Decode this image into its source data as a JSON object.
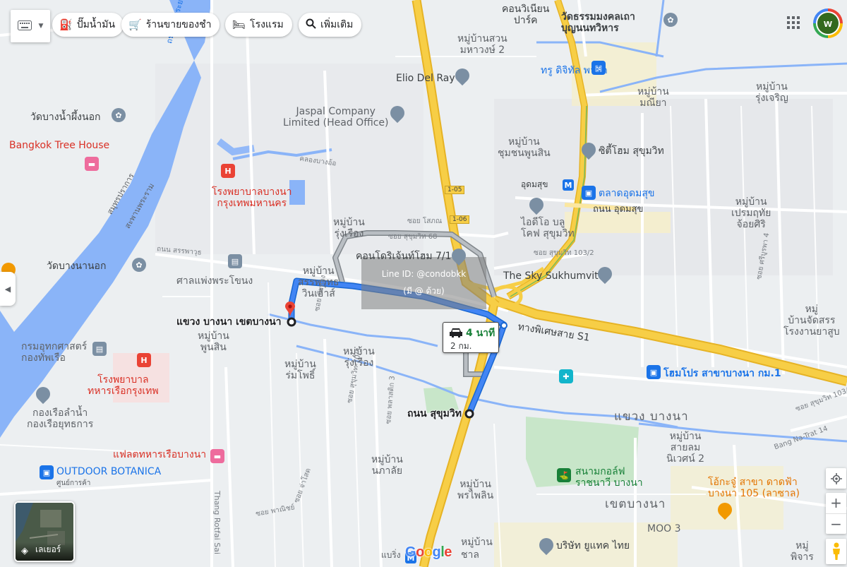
{
  "toolbar": {
    "keyboard_icon": "keyboard-icon",
    "chips": [
      {
        "icon": "gas-station-icon",
        "label": "ปั๊มน้ำมัน"
      },
      {
        "icon": "shopping-cart-icon",
        "label": "ร้านขายของชำ"
      },
      {
        "icon": "hotel-bed-icon",
        "label": "โรงแรม"
      },
      {
        "icon": "search-icon",
        "label": "เพิ่มเติม"
      }
    ],
    "avatar_letter": "w"
  },
  "route": {
    "duration": "4 นาที",
    "distance": "2 กม.",
    "destination_label": "แขวง บางนา เขตบางนา",
    "origin_label": "ถนน สุขุมวิท",
    "color": "#4285f4",
    "alt_color": "#9aa0a6"
  },
  "watermark": {
    "line1": "Line ID: @condobkk",
    "line2": "(มี @ ด้วย)"
  },
  "places": [
    {
      "text": "คอนวิเนียน\nปาร์ค",
      "style": "place-dark"
    },
    {
      "text": "หมู่บ้านสวน\nมหาวงษ์ 2",
      "style": "place"
    },
    {
      "text": "วัดธรรมมงคลเถา\nบุญนนทวิหาร",
      "style": "place-dark"
    },
    {
      "text": "Elio Del Ray",
      "style": "place-dark"
    },
    {
      "text": "ทรู ดิจิทัล พาร์ค",
      "style": "blue-plain"
    },
    {
      "text": "หมู่บ้าน\nมณียา",
      "style": "place"
    },
    {
      "text": "หมู่บ้าน\nรุ่งเจริญ",
      "style": "place"
    },
    {
      "text": "วัดบางน้ำผึ้งนอก",
      "style": "place-dark"
    },
    {
      "text": "Bangkok Tree House",
      "style": "red"
    },
    {
      "text": "Jaspal Company\nLimited (Head Office)",
      "style": "place"
    },
    {
      "text": "หมู่บ้าน\nชุมชนพูนสิน",
      "style": "place"
    },
    {
      "text": "ซิตี้โฮม สุขุมวิท",
      "style": "place-dark"
    },
    {
      "text": "อุดมสุข",
      "style": "place-dark"
    },
    {
      "text": "ตลาดอุดมสุข",
      "style": "blue-plain"
    },
    {
      "text": "โรงพยาบาลบางนา\nกรุงเทพมหานคร",
      "style": "red"
    },
    {
      "text": "หมู่บ้าน\nรุ่งเรือง",
      "style": "place"
    },
    {
      "text": "ไอดีโอ บลู\nโคฟ สุขุมวิท",
      "style": "place"
    },
    {
      "text": "หมู่บ้าน\nเปรมฤทัย\nจ้อยศิริ",
      "style": "place"
    },
    {
      "text": "คอนโดริเจ้นท์โฮม 7/1",
      "style": "place-dark"
    },
    {
      "text": "วัดบางนานอก",
      "style": "place-dark"
    },
    {
      "text": "หมู่บ้าน\nสรรพวุทธ\nวินเฮ้าส์",
      "style": "place"
    },
    {
      "text": "ศาลแพ่งพระโขนง",
      "style": "place"
    },
    {
      "text": "The Sky Sukhumvit",
      "style": "place-dark"
    },
    {
      "text": "หมู่\nบ้านจัดสรร\nโรงงานยาสูบ",
      "style": "place"
    },
    {
      "text": "หมู่บ้าน\nพูนสิน",
      "style": "place"
    },
    {
      "text": "ทางพิเศษสาย S1",
      "style": "place-dark"
    },
    {
      "text": "กรมอุทกศาสตร์\nกองทัพเรือ",
      "style": "place"
    },
    {
      "text": "หมู่บ้าน\nรุ่งเรือง",
      "style": "place"
    },
    {
      "text": "หมู่บ้าน\nร่มโพธิ์",
      "style": "place"
    },
    {
      "text": "โรงพยาบาล\nทหารเรือกรุงเทพ",
      "style": "red"
    },
    {
      "text": "โฮมโปร สาขาบางนา กม.1",
      "style": "blue"
    },
    {
      "text": "กองเรือลำน้ำ\nกองเรือยุทธการ",
      "style": "place"
    },
    {
      "text": "แขวง บางนา",
      "style": "area-big"
    },
    {
      "text": "หมู่บ้าน\nสายลม\nนิเวศน์ 2",
      "style": "place"
    },
    {
      "text": "แฟลตทหารเรือบางนา",
      "style": "red"
    },
    {
      "text": "OUTDOOR BOTANICA",
      "style": "blue-plain"
    },
    {
      "text": "ศูนย์การค้า",
      "style": "small"
    },
    {
      "text": "หมู่บ้าน\nนภาลัย",
      "style": "place"
    },
    {
      "text": "สนามกอล์ฟ\nราชนาวี บางนา",
      "style": "green"
    },
    {
      "text": "โอ้กะจู๋ สาขา ดาดฟ้า\nบางนา 105 (ลาซาล)",
      "style": "orange"
    },
    {
      "text": "หมู่บ้าน\nพรไพลิน",
      "style": "place"
    },
    {
      "text": "เขตบางนา",
      "style": "area-big"
    },
    {
      "text": "MOO 3",
      "style": "place"
    },
    {
      "text": "บริษัท ยูแทค ไทย",
      "style": "place-dark"
    },
    {
      "text": "หมู่บ้าน",
      "style": "place"
    },
    {
      "text": "ชาล",
      "style": "place"
    },
    {
      "text": "แบริ่ง",
      "style": "place"
    },
    {
      "text": "หมู่\nพิจาร",
      "style": "place"
    }
  ],
  "roads": [
    "ถนน อุดมสุข",
    "ซอย สุขุมวิท 103/2",
    "ถนน สรรพาวุธ",
    "คลองบางอ้อ",
    "ซอย โสภณ",
    "ซอย สุขุมวิท 68",
    "ซอย สุขุมวิท 70/3",
    "ซอย พลาสติก 3",
    "ซอย จ่าโสด",
    "ซอย พาณิชย์",
    "Thang Rotfai Sai",
    "ซอย ชัยทอง",
    "ซอย สุขุมวิท 103/3",
    "1-05",
    "1-06",
    "Bang Na-Trat 14",
    "ถนนเจ้าพระยา",
    "สมุทรปราการ",
    "สะพานพระราม",
    "ซอย ศรีบูรพา 4"
  ],
  "controls": {
    "layers_label": "เลเยอร์",
    "zoom_in": "+",
    "zoom_out": "−",
    "locate_icon": "my-location-icon",
    "pegman_icon": "pegman-icon",
    "apps_icon": "apps-grid-icon",
    "collapse_icon": "chevron-left-icon"
  },
  "branding": {
    "google_letters": [
      "G",
      "o",
      "o",
      "g",
      "l",
      "e"
    ],
    "google_colors": [
      "#4285f4",
      "#ea4335",
      "#fbbc05",
      "#4285f4",
      "#34a853",
      "#ea4335"
    ]
  },
  "colors": {
    "water": "#8ab4f8",
    "highway": "#f7ce46",
    "highway_edge": "#e6b325",
    "park": "#c8e6c9",
    "route": "#4285f4"
  }
}
